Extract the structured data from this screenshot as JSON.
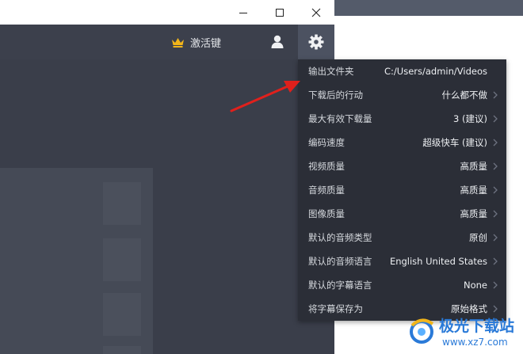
{
  "header": {
    "activation_label": "激活键"
  },
  "settings_menu": {
    "items": [
      {
        "label": "输出文件夹",
        "value": "C:/Users/admin/Videos",
        "has_submenu": false
      },
      {
        "label": "下载后的行动",
        "value": "什么都不做",
        "has_submenu": true
      },
      {
        "label": "最大有效下载量",
        "value": "3 (建议)",
        "has_submenu": true
      },
      {
        "label": "编码速度",
        "value": "超级快车 (建议)",
        "has_submenu": true
      },
      {
        "label": "视频质量",
        "value": "高质量",
        "has_submenu": true
      },
      {
        "label": "音频质量",
        "value": "高质量",
        "has_submenu": true
      },
      {
        "label": "图像质量",
        "value": "高质量",
        "has_submenu": true
      },
      {
        "label": "默认的音频类型",
        "value": "原创",
        "has_submenu": true
      },
      {
        "label": "默认的音频语言",
        "value": "English United States",
        "has_submenu": true
      },
      {
        "label": "默认的字幕语言",
        "value": "None",
        "has_submenu": true
      },
      {
        "label": "将字幕保存为",
        "value": "原始格式",
        "has_submenu": true
      }
    ]
  },
  "watermark": {
    "text": "极光下载站",
    "url": "www.xz7.com"
  },
  "colors": {
    "accent_crown": "#f2b51a",
    "annotation_arrow": "#e0201c",
    "menu_bg": "#2b2e37",
    "toolbar_bg": "#3c404c"
  }
}
